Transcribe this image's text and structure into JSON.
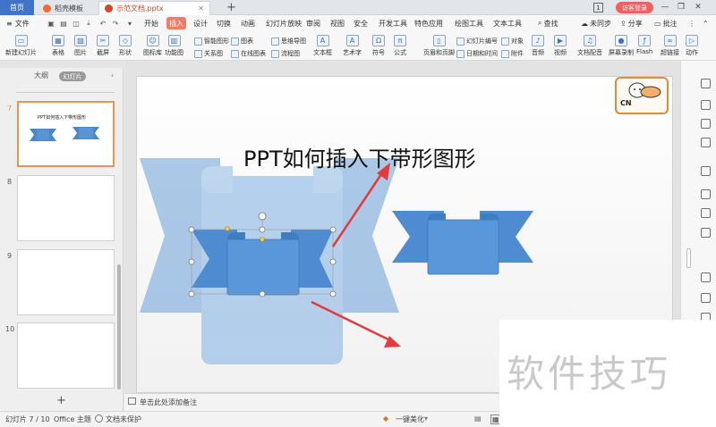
{
  "titlebar": {
    "home_tab": "首页",
    "tab1": "稻壳模板",
    "tab2": "示范文档.pptx",
    "badge": "1",
    "login": "访客登录"
  },
  "menu": {
    "file": "文件",
    "items": [
      "开始",
      "插入",
      "设计",
      "切换",
      "动画",
      "幻灯片放映",
      "审阅",
      "视图",
      "安全",
      "开发工具",
      "特色应用",
      "绘图工具",
      "文本工具"
    ],
    "active": "插入",
    "search": "查找",
    "sync": "未同步",
    "share": "分享",
    "comment": "批注"
  },
  "ribbon": {
    "new_slide": "新建幻灯片",
    "table": "表格",
    "picture": "图片",
    "screenshot": "截屏",
    "shape": "形状",
    "icon_lib": "图标库",
    "func_chart": "功能图",
    "smart_art": "智能图形",
    "chart": "图表",
    "relation": "关系图",
    "online_chart": "在线图表",
    "mind_map": "思维导图",
    "flow_chart": "流程图",
    "textbox": "文本框",
    "art_text": "艺术字",
    "symbol": "符号",
    "formula": "公式",
    "header_footer": "页眉和页脚",
    "slide_number": "幻灯片编号",
    "object": "对象",
    "date_time": "日期和时间",
    "attachment": "附件",
    "audio": "音频",
    "video": "视频",
    "doc_voice": "文档配音",
    "screen_record": "屏幕录制",
    "flash": "Flash",
    "hyperlink": "超链接",
    "action": "动作"
  },
  "leftpanel": {
    "tab_outline": "大纲",
    "tab_slides": "幻灯片",
    "slides": [
      {
        "num": "7",
        "title": "PPT如何插入下带形图形"
      },
      {
        "num": "8",
        "title": ""
      },
      {
        "num": "9",
        "title": ""
      },
      {
        "num": "10",
        "title": ""
      }
    ],
    "add": "+"
  },
  "slide": {
    "title": "PPT如何插入下带形图形",
    "logo_text": "CN"
  },
  "notes": {
    "placeholder": "单击此处添加备注"
  },
  "status": {
    "slide_count": "幻灯片 7 / 10",
    "theme": "Office 主题",
    "protect": "文档未保护",
    "beautify": "一键美化"
  },
  "watermark": "软件技巧",
  "colors": {
    "accent": "#f47c5e",
    "ribbon_blue": "#5b9bd5",
    "ribbon_blue_light": "#a7c4e6",
    "arrow_red": "#e23b3b"
  }
}
